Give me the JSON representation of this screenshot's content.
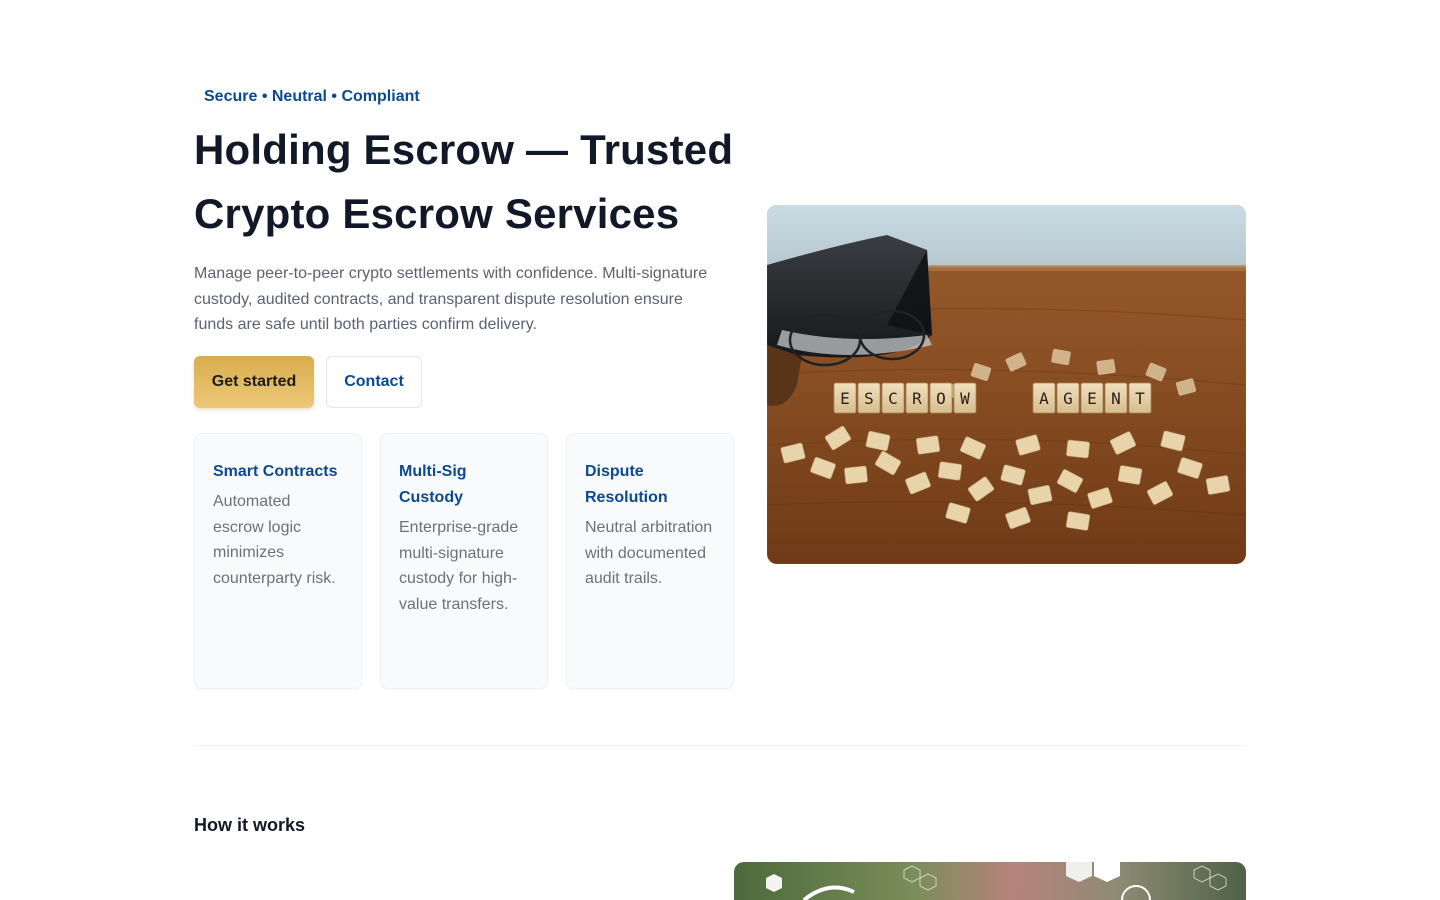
{
  "hero": {
    "eyebrow": "Secure • Neutral • Compliant",
    "title": "Holding Escrow — Trusted Crypto Escrow Services",
    "lead": "Manage peer-to-peer crypto settlements with confidence. Multi-signature custody, audited contracts, and transparent dispute resolution ensure funds are safe until both parties confirm delivery.",
    "primary_button": "Get started",
    "secondary_button": "Contact",
    "image_tiles": {
      "word1": [
        "E",
        "S",
        "C",
        "R",
        "O",
        "W"
      ],
      "word2": [
        "A",
        "G",
        "E",
        "N",
        "T"
      ]
    }
  },
  "features": [
    {
      "title": "Smart Contracts",
      "text": "Automated escrow logic minimizes counterparty risk."
    },
    {
      "title": "Multi-Sig Custody",
      "text": "Enterprise-grade multi-signature custody for high-value transfers."
    },
    {
      "title": "Dispute Resolution",
      "text": "Neutral arbitration with documented audit trails."
    }
  ],
  "how_it_works": {
    "title": "How it works"
  },
  "colors": {
    "accent": "#0b4a8f",
    "primary_button": "#e2bb63",
    "heading": "#111827",
    "body_text": "#5b6270"
  }
}
